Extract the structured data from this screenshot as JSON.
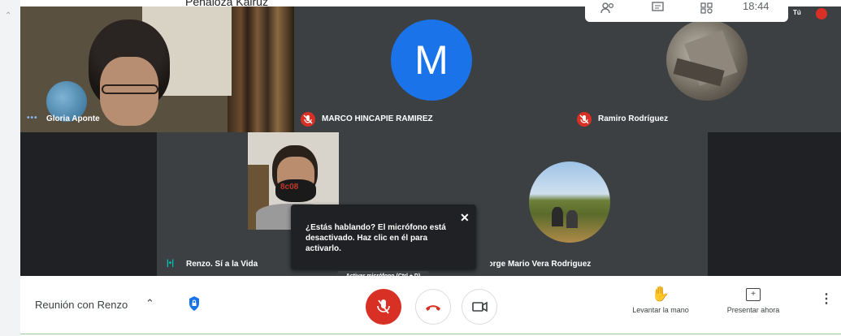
{
  "overlay_name": "Peñaloza Kairuz",
  "topbar": {
    "time": "18:44",
    "you_label": "Tú"
  },
  "participants": [
    {
      "name": "Gloria Aponte",
      "status": "speaking-dots"
    },
    {
      "name": "MARCO HINCAPIE RAMIREZ",
      "initial": "M",
      "avatar_color": "#1a73e8",
      "status": "muted"
    },
    {
      "name": "Ramiro Rodríguez",
      "status": "muted"
    },
    {
      "name": "Renzo. Sí a la Vida",
      "status": "speaking"
    },
    {
      "name": "Jorge Mario Vera Rodriguez",
      "status": "none"
    }
  ],
  "toast": {
    "message": "¿Estás hablando? El micrófono está desactivado. Haz clic en él para activarlo.",
    "close_icon": "close-icon"
  },
  "tooltip": "Activar micrófono (Ctrl + D)",
  "bottom_bar": {
    "meeting_title": "Reunión con Renzo",
    "raise_hand_label": "Levantar la mano",
    "present_label": "Presentar ahora"
  },
  "colors": {
    "stage": "#202124",
    "mute_red": "#d93025",
    "avatar_blue": "#1a73e8",
    "lock_blue": "#1a73e8"
  }
}
